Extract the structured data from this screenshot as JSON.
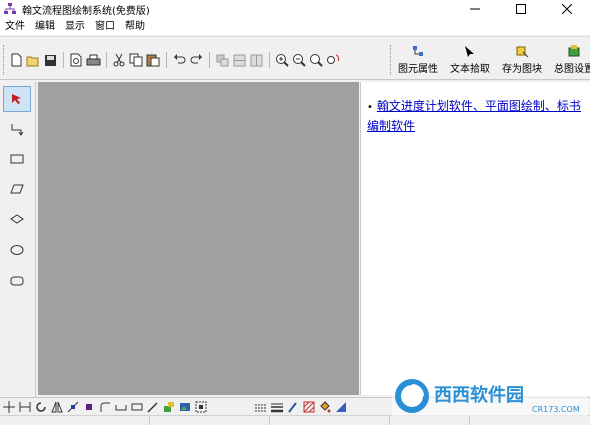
{
  "window": {
    "title": "翰文流程图绘制系统(免费版)"
  },
  "menu": [
    {
      "label": "文件"
    },
    {
      "label": "编辑"
    },
    {
      "label": "显示"
    },
    {
      "label": "窗口"
    },
    {
      "label": "帮助"
    }
  ],
  "toolbar_right": [
    {
      "label": "图元属性",
      "icon": "element-properties-icon"
    },
    {
      "label": "文本拾取",
      "icon": "text-pick-icon"
    },
    {
      "label": "存为图块",
      "icon": "save-block-icon"
    },
    {
      "label": "总图设置",
      "icon": "diagram-settings-icon"
    }
  ],
  "right_panel": {
    "link_line1": "翰文进度计划软件、平面图绘制、标书",
    "link_line2": "编制软件"
  },
  "watermark": {
    "text": "西西软件园",
    "sub": "CR173.COM"
  },
  "colors": {
    "canvas": "#a0a0a0",
    "link": "#0000cc",
    "selected_tool": "#cfe3f7"
  }
}
